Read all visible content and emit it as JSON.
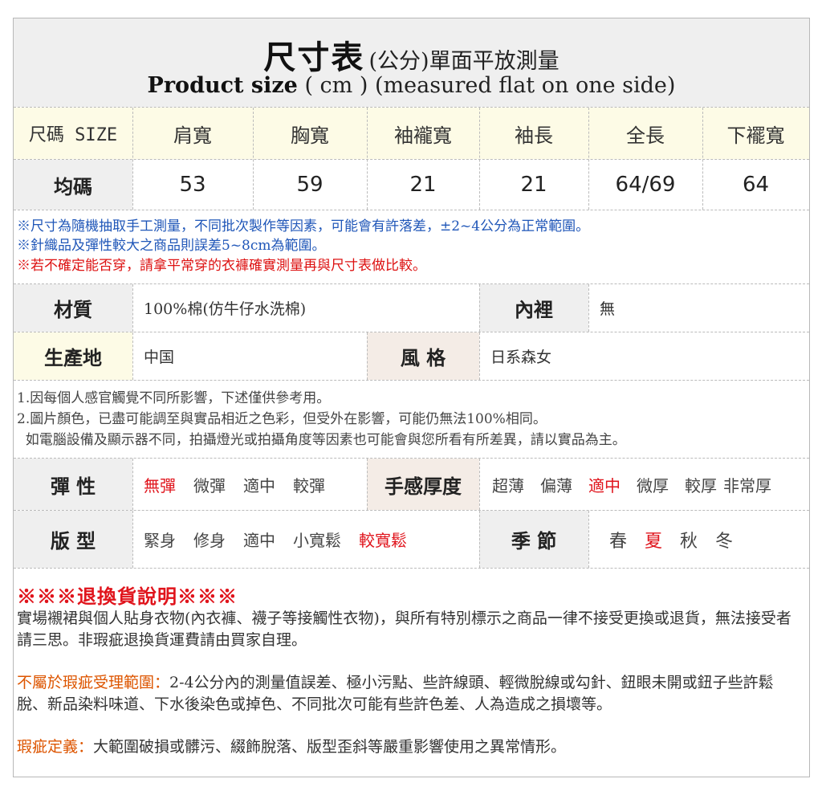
{
  "title": {
    "cn_main": "尺寸表",
    "cn_sub": "(公分)單面平放測量",
    "en_bold": "Product size",
    "en_rest": " ( cm ) (measured flat on one side)"
  },
  "size_table": {
    "headers": [
      "尺碼 SIZE",
      "肩寬",
      "胸寬",
      "袖襱寬",
      "袖長",
      "全長",
      "下襬寬"
    ],
    "row_label": "均碼",
    "values": [
      "53",
      "59",
      "21",
      "21",
      "64/69",
      "64"
    ]
  },
  "notes": [
    "※尺寸為隨機抽取手工測量，不同批次製作等因素，可能會有許落差，±2~4公分為正常範圍。",
    "※針織品及彈性較大之商品則誤差5~8cm為範圍。",
    "※若不確定能否穿，請拿平常穿的衣褲確實測量再與尺寸表做比較。"
  ],
  "material": {
    "label": "材質",
    "value": "100%棉(仿牛仔水洗棉)",
    "lining_label": "內裡",
    "lining_value": "無"
  },
  "origin": {
    "label": "生產地",
    "value": "中国",
    "style_label": "風 格",
    "style_value": "日系森女"
  },
  "disclaimers": [
    "1.因每個人感官觸覺不同所影響，下述僅供參考用。",
    "2.圖片顏色，已盡可能調至與實品相近之色彩，但受外在影響，可能仍無法100%相同。",
    "  如電腦設備及顯示器不同，拍攝燈光或拍攝角度等因素也可能會與您所看有所差異，請以實品為主。"
  ],
  "elasticity": {
    "label": "彈 性",
    "options": [
      "無彈",
      "微彈",
      "適中",
      "較彈"
    ],
    "selected": 0
  },
  "thickness": {
    "label": "手感厚度",
    "options": [
      "超薄",
      "偏薄",
      "適中",
      "微厚",
      "較厚",
      "非常厚"
    ],
    "selected": 2
  },
  "fit": {
    "label": "版 型",
    "options": [
      "緊身",
      "修身",
      "適中",
      "小寬鬆",
      "較寬鬆"
    ],
    "selected": 4
  },
  "season": {
    "label": "季 節",
    "options": [
      "春",
      "夏",
      "秋",
      "冬"
    ],
    "selected": 1
  },
  "returns": {
    "title": "※※※退換貨說明※※※",
    "policy": "實場襯裙與個人貼身衣物(內衣褲、襪子等接觸性衣物)，與所有特別標示之商品一律不接受更換或退貨，無法接受者請三思。非瑕疵退換貨運費請由買家自理。",
    "not_defect_label": "不屬於瑕疵受理範圍：",
    "not_defect_text": "2-4公分內的測量值誤差、極小污點、些許線頭、輕微脫線或勾針、鈕眼未開或鈕子些許鬆脫、新品染料味道、下水後染色或掉色、不同批次可能有些許色差、人為造成之損壞等。",
    "defect_label": "瑕疵定義：",
    "defect_text": "大範圍破損或髒污、綴飾脫落、版型歪斜等嚴重影響使用之異常情形。"
  },
  "colors": {
    "accent_red": "#e0141c",
    "note_blue": "#1f56b8",
    "label_orange": "#dd5500"
  }
}
